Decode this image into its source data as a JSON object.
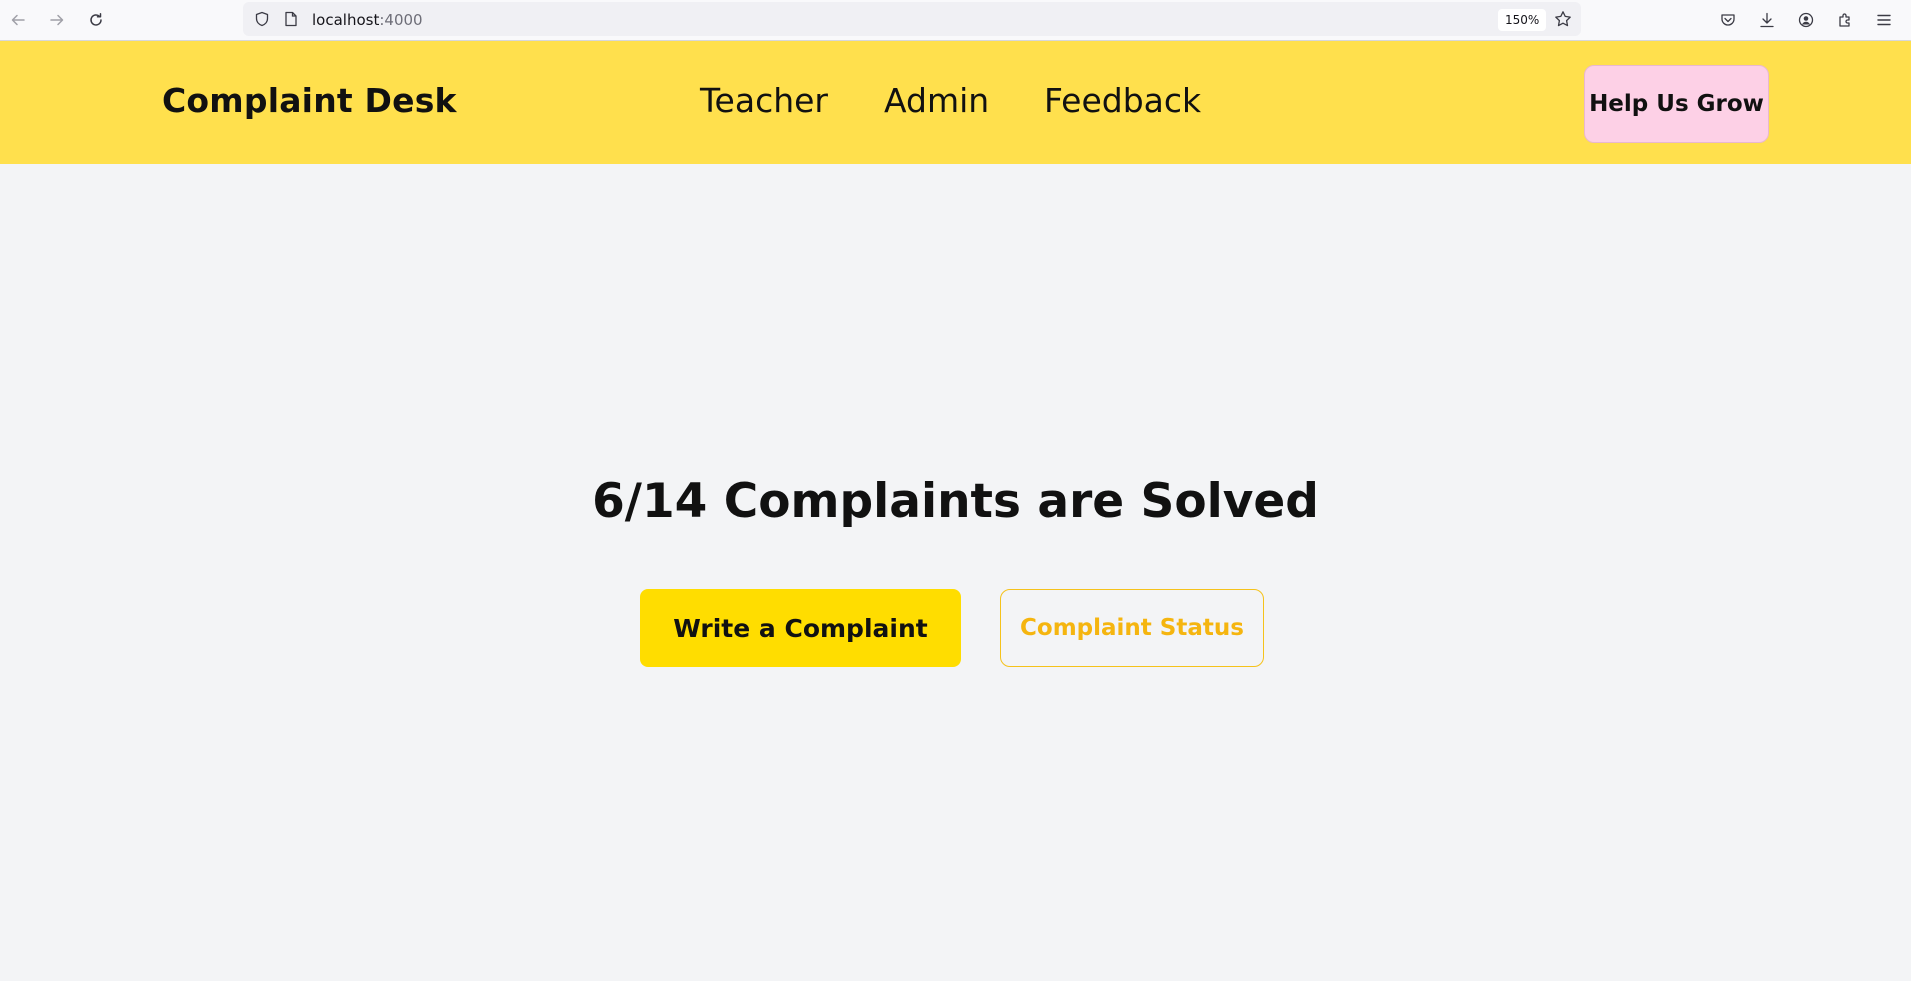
{
  "browser": {
    "url_host": "localhost",
    "url_port": ":4000",
    "zoom": "150%"
  },
  "header": {
    "brand": "Complaint Desk",
    "nav": [
      {
        "label": "Teacher"
      },
      {
        "label": "Admin"
      },
      {
        "label": "Feedback"
      }
    ],
    "help_button": "Help Us Grow"
  },
  "main": {
    "headline": "6/14 Complaints are Solved",
    "write_button": "Write a Complaint",
    "status_button": "Complaint Status"
  },
  "colors": {
    "header_bg": "#ffe04d",
    "page_bg": "#f3f4f6",
    "help_button_bg": "#fdd0e6",
    "primary_button_bg": "#ffdd00",
    "secondary_button_accent": "#f5b50f"
  }
}
